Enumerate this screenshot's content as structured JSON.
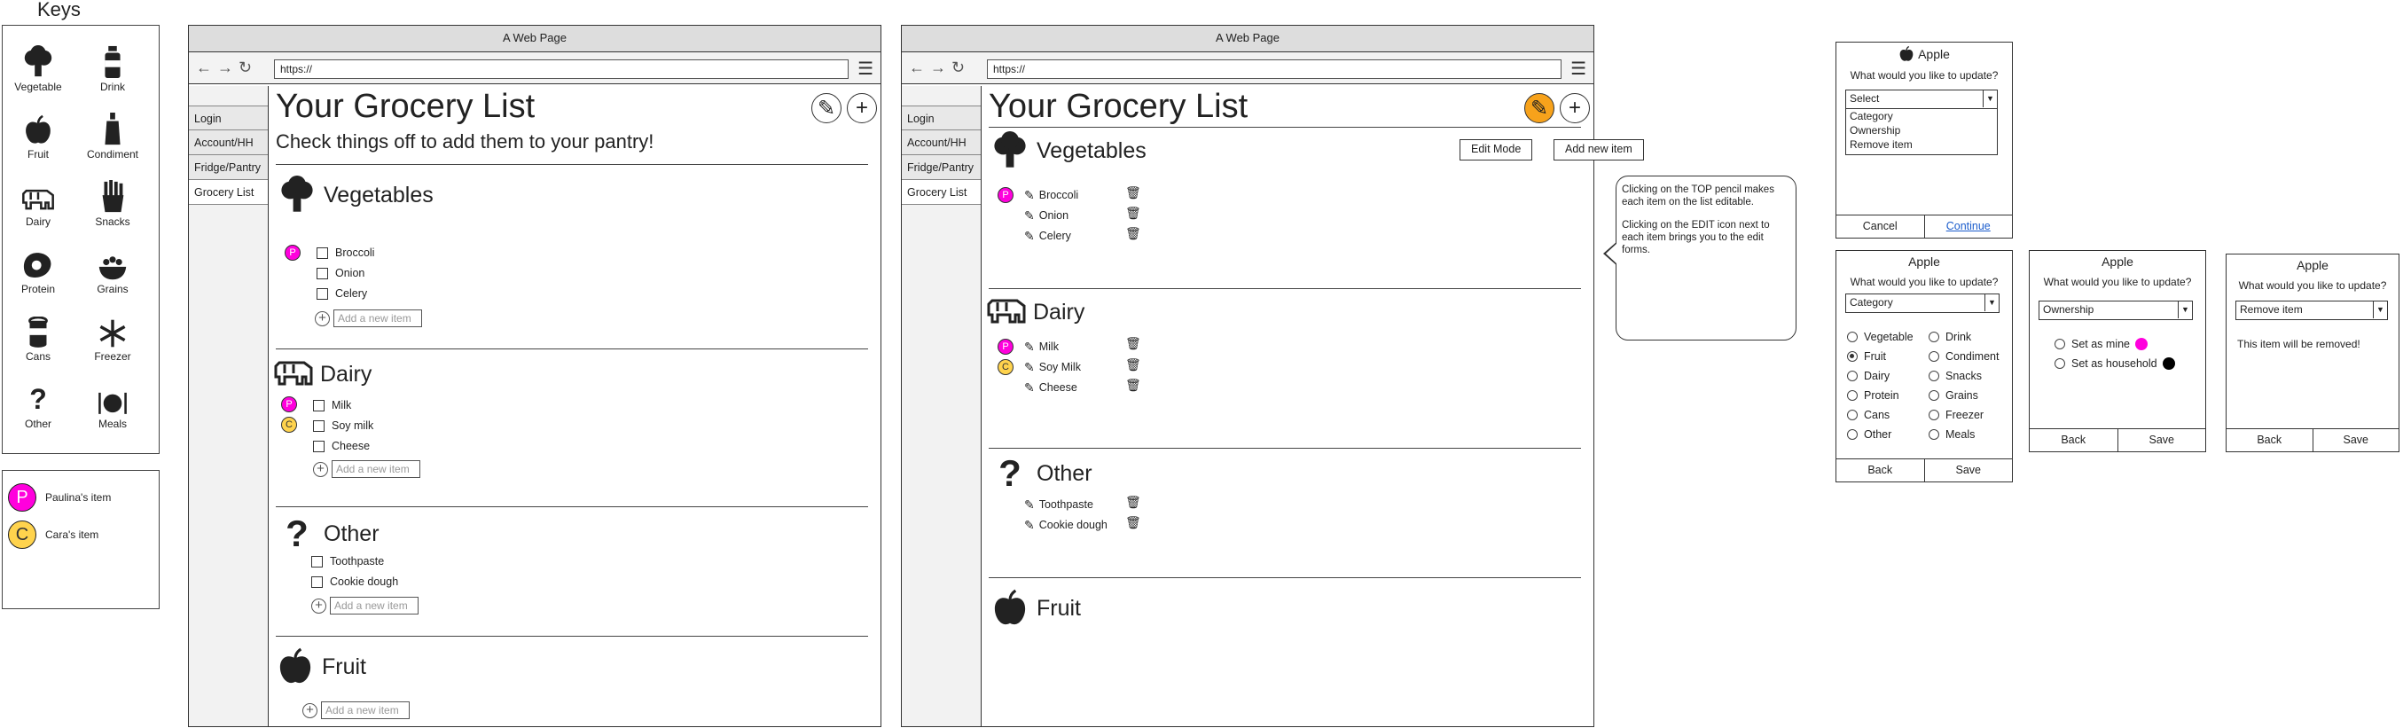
{
  "keys": {
    "title": "Keys",
    "items": [
      {
        "label": "Vegetable",
        "icon": "vegetable-icon"
      },
      {
        "label": "Drink",
        "icon": "drink-icon"
      },
      {
        "label": "Fruit",
        "icon": "fruit-icon"
      },
      {
        "label": "Condiment",
        "icon": "condiment-icon"
      },
      {
        "label": "Dairy",
        "icon": "dairy-icon"
      },
      {
        "label": "Snacks",
        "icon": "snacks-icon"
      },
      {
        "label": "Protein",
        "icon": "protein-icon"
      },
      {
        "label": "Grains",
        "icon": "grains-icon"
      },
      {
        "label": "Cans",
        "icon": "cans-icon"
      },
      {
        "label": "Freezer",
        "icon": "freezer-icon"
      },
      {
        "label": "Other",
        "icon": "other-icon"
      },
      {
        "label": "Meals",
        "icon": "meals-icon"
      }
    ],
    "owners": [
      {
        "badge": "P",
        "label": "Paulina's item",
        "color": "#ff00dd"
      },
      {
        "badge": "C",
        "label": "Cara's item",
        "color": "#ffd34d"
      }
    ]
  },
  "browser1": {
    "window_title": "A Web Page",
    "url": "https://",
    "nav": [
      "Login",
      "Account/HH",
      "Fridge/Pantry",
      "Grocery List"
    ],
    "title": "Your Grocery List",
    "subtitle": "Check things off to add them to your pantry!",
    "add_placeholder": "Add a new item",
    "categories": [
      {
        "name": "Vegetables",
        "items": [
          "Broccoli",
          "Onion",
          "Celery"
        ]
      },
      {
        "name": "Dairy",
        "items": [
          "Milk",
          "Soy milk",
          "Cheese"
        ]
      },
      {
        "name": "Other",
        "items": [
          "Toothpaste",
          "Cookie dough"
        ]
      },
      {
        "name": "Fruit",
        "items": []
      }
    ]
  },
  "browser2": {
    "window_title": "A Web Page",
    "url": "https://",
    "nav": [
      "Login",
      "Account/HH",
      "Fridge/Pantry",
      "Grocery List"
    ],
    "title": "Your Grocery List",
    "edit_mode_label": "Edit Mode",
    "add_new_item_label": "Add new item",
    "callout": [
      "Clicking on the TOP pencil makes each item on the list editable.",
      "Clicking on the EDIT icon next to each item brings you to the edit forms."
    ],
    "categories": [
      {
        "name": "Vegetables",
        "items": [
          "Broccoli",
          "Onion",
          "Celery"
        ]
      },
      {
        "name": "Dairy",
        "items": [
          "Milk",
          "Soy Milk",
          "Cheese"
        ]
      },
      {
        "name": "Other",
        "items": [
          "Toothpaste",
          "Cookie dough"
        ]
      },
      {
        "name": "Fruit",
        "items": []
      }
    ]
  },
  "dialog_select": {
    "title": "Apple",
    "question": "What would you like to update?",
    "selected": "Select",
    "options": [
      "Category",
      "Ownership",
      "Remove item"
    ],
    "cancel": "Cancel",
    "continue": "Continue"
  },
  "dialog_category": {
    "title": "Apple",
    "question": "What would you like to update?",
    "selected": "Category",
    "options_left": [
      "Vegetable",
      "Fruit",
      "Dairy",
      "Protein",
      "Cans",
      "Other"
    ],
    "options_right": [
      "Drink",
      "Condiment",
      "Snacks",
      "Grains",
      "Freezer",
      "Meals"
    ],
    "checked": "Fruit",
    "back": "Back",
    "save": "Save"
  },
  "dialog_ownership": {
    "title": "Apple",
    "question": "What would you like to update?",
    "selected": "Ownership",
    "opt_mine": "Set as mine",
    "opt_household": "Set as household",
    "mine_color": "#ff00dd",
    "household_color": "#000000",
    "back": "Back",
    "save": "Save"
  },
  "dialog_remove": {
    "title": "Apple",
    "question": "What would you like to update?",
    "selected": "Remove item",
    "message": "This item will be removed!",
    "back": "Back",
    "save": "Save"
  }
}
